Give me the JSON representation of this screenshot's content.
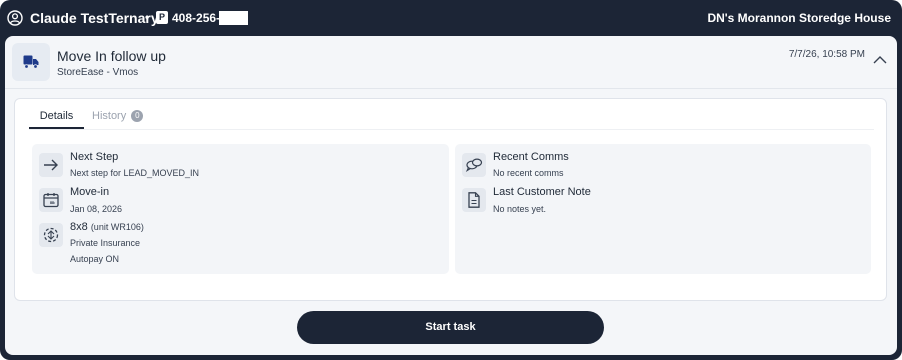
{
  "topbar": {
    "customer_name": "Claude TestTernary",
    "separator": "•",
    "phone_badge": "P",
    "phone": "408-256-",
    "facility": "DN's Morannon Storedge House"
  },
  "header": {
    "title": "Move In follow up",
    "subtitle": "StoreEase - Vmos",
    "timestamp": "7/7/26, 10:58 PM"
  },
  "tabs": {
    "details": "Details",
    "history": "History",
    "history_count": "0"
  },
  "left": {
    "next_step": {
      "title": "Next Step",
      "sub": "Next step for LEAD_MOVED_IN"
    },
    "move_in": {
      "title": "Move-in",
      "sub": "Jan 08, 2026"
    },
    "unit": {
      "size": "8x8",
      "unit": "(unit WR106)",
      "insurance": "Private Insurance",
      "autopay": "Autopay ON"
    }
  },
  "right": {
    "recent_comms": {
      "title": "Recent Comms",
      "sub": "No recent comms"
    },
    "last_note": {
      "title": "Last Customer Note",
      "sub": "No notes yet."
    }
  },
  "actions": {
    "start_task": "Start task"
  },
  "colors": {
    "navy": "#1c2536",
    "card": "#f4f6f9",
    "muted": "#9ca3af"
  }
}
